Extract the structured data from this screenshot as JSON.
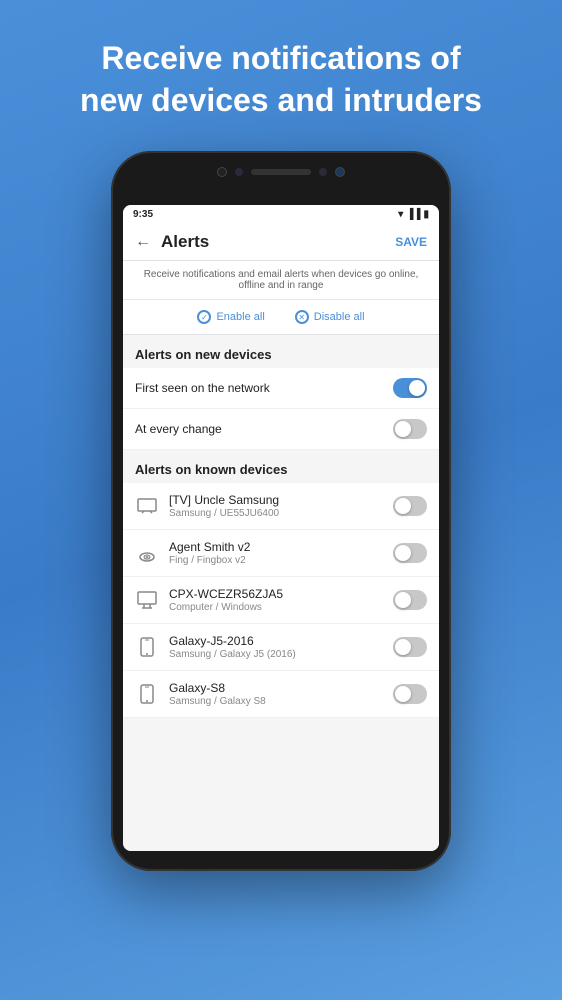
{
  "headline": {
    "line1": "Receive notifications of",
    "line2": "new devices and intruders"
  },
  "status_bar": {
    "time": "9:35"
  },
  "app_bar": {
    "title": "Alerts",
    "save_label": "SAVE",
    "back_label": "←"
  },
  "description": {
    "text": "Receive notifications and email alerts when devices go online, offline and in range"
  },
  "actions": {
    "enable_all": "Enable all",
    "disable_all": "Disable all"
  },
  "sections": {
    "new_devices": {
      "header": "Alerts on new devices",
      "items": [
        {
          "name": "First seen on the network",
          "sub": "",
          "icon": "none",
          "on": true
        },
        {
          "name": "At every change",
          "sub": "",
          "icon": "none",
          "on": false
        }
      ]
    },
    "known_devices": {
      "header": "Alerts on known devices",
      "items": [
        {
          "name": "[TV] Uncle Samsung",
          "sub": "Samsung / UE55JU6400",
          "icon": "tv",
          "on": false
        },
        {
          "name": "Agent Smith v2",
          "sub": "Fing / Fingbox v2",
          "icon": "router",
          "on": false
        },
        {
          "name": "CPX-WCEZR56ZJA5",
          "sub": "Computer / Windows",
          "icon": "desktop",
          "on": false
        },
        {
          "name": "Galaxy-J5-2016",
          "sub": "Samsung / Galaxy J5 (2016)",
          "icon": "phone",
          "on": false
        },
        {
          "name": "Galaxy-S8",
          "sub": "Samsung / Galaxy S8",
          "icon": "phone",
          "on": false
        }
      ]
    }
  }
}
